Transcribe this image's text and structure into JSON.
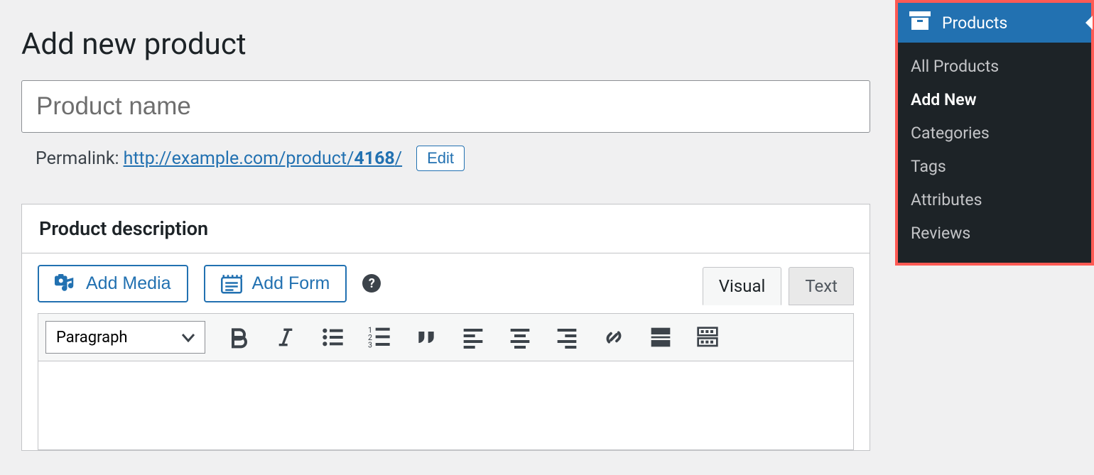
{
  "page": {
    "title": "Add new product"
  },
  "title_field": {
    "placeholder": "Product name",
    "value": ""
  },
  "permalink": {
    "label": "Permalink:",
    "base": "http://example.com/product/",
    "slug": "4168",
    "trail": "/",
    "edit_label": "Edit"
  },
  "description_box": {
    "title": "Product description",
    "add_media_label": "Add Media",
    "add_form_label": "Add Form"
  },
  "editor_tabs": {
    "visual": "Visual",
    "text": "Text",
    "active": "visual"
  },
  "format_select": {
    "value": "Paragraph"
  },
  "sidebar": {
    "section_label": "Products",
    "items": [
      {
        "label": "All Products",
        "current": false
      },
      {
        "label": "Add New",
        "current": true
      },
      {
        "label": "Categories",
        "current": false
      },
      {
        "label": "Tags",
        "current": false
      },
      {
        "label": "Attributes",
        "current": false
      },
      {
        "label": "Reviews",
        "current": false
      }
    ]
  }
}
